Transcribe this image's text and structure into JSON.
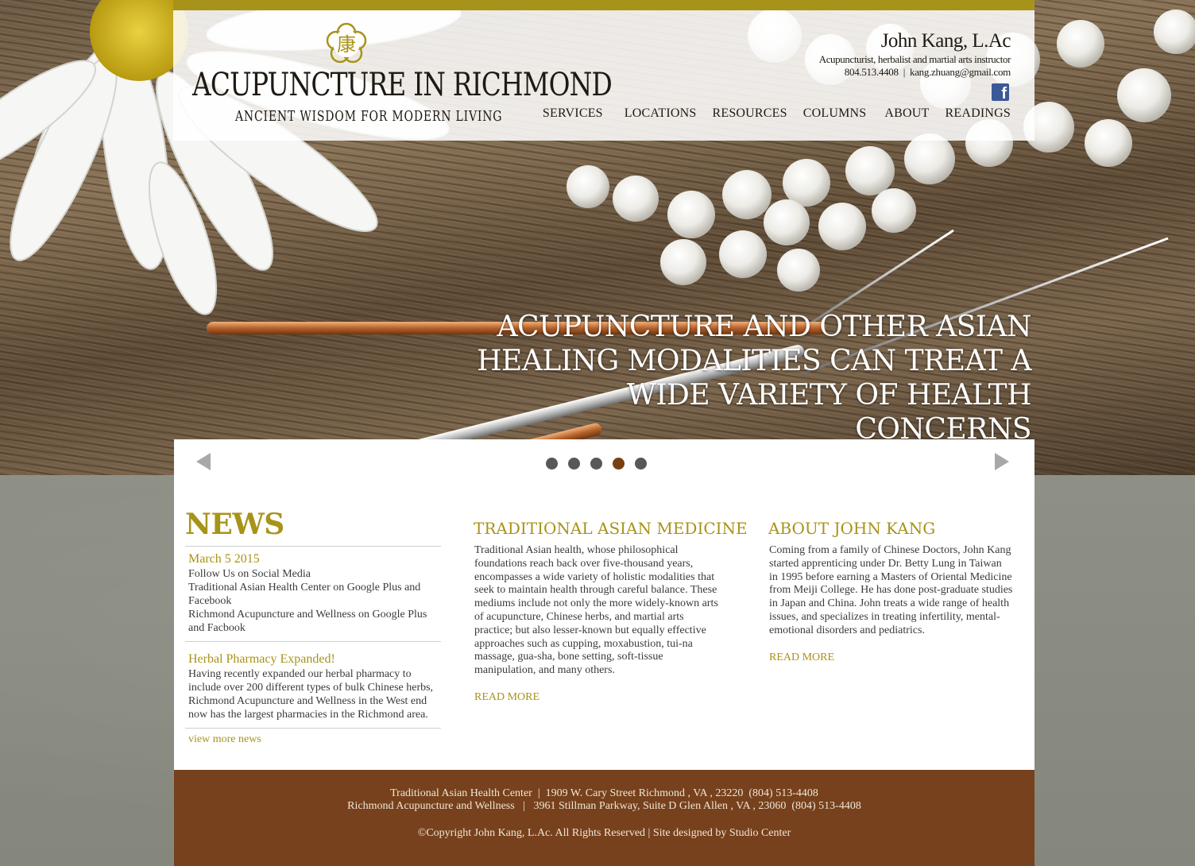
{
  "header": {
    "logo_title": "ACUPUNCTURE IN RICHMOND",
    "logo_tagline": "ANCIENT WISDOM FOR MODERN LIVING",
    "contact_name": "John Kang, L.Ac",
    "contact_role": "Acupuncturist, herbalist and martial arts instructor",
    "contact_phone": "804.513.4408",
    "contact_separator": "|",
    "contact_email": "kang.zhuang@gmail.com",
    "facebook_icon_glyph": "f"
  },
  "nav": {
    "items": [
      {
        "label": "SERVICES"
      },
      {
        "label": "LOCATIONS"
      },
      {
        "label": "RESOURCES"
      },
      {
        "label": "COLUMNS"
      },
      {
        "label": "ABOUT"
      },
      {
        "label": "READINGS"
      }
    ]
  },
  "hero": {
    "line1": "ACUPUNCTURE AND OTHER ASIAN",
    "line2": "HEALING MODALITIES CAN TREAT A",
    "line3": "WIDE VARIETY OF HEALTH CONCERNS"
  },
  "slider": {
    "dot_count": 5,
    "active_index": 3,
    "active_color": "#7a3e14",
    "dot_color": "#58585a"
  },
  "news": {
    "heading": "NEWS",
    "items": [
      {
        "date": "March 5 2015",
        "lines": [
          "Follow Us on Social Media",
          "Traditional Asian Health Center on Google Plus and Facebook",
          "Richmond Acupuncture and Wellness on Google Plus and Facbook"
        ]
      },
      {
        "title": "Herbal Pharmacy Expanded!",
        "body": "Having recently expanded our herbal pharmacy to include over 200 different types of bulk Chinese herbs, Richmond Acupuncture and Wellness in the West end now has the largest pharmacies in the Richmond area."
      }
    ],
    "more_link": "view more news"
  },
  "tam": {
    "heading": "TRADITIONAL ASIAN MEDICINE",
    "body": "Traditional Asian health, whose philosophical foundations reach back over five-thousand years, encompasses a wide variety of holistic modalities that seek to maintain health through careful balance. These mediums include not only the more widely-known arts of acupuncture, Chinese herbs, and martial arts practice; but also lesser-known but equally effective approaches such as cupping, moxabustion, tui-na massage, gua-sha, bone setting, soft-tissue manipulation, and many others.",
    "read_more": "READ MORE"
  },
  "about": {
    "heading": "ABOUT JOHN KANG",
    "body": "Coming from a family of Chinese Doctors, John Kang started apprenticing under Dr. Betty Lung in Taiwan in 1995 before earning a Masters of Oriental Medicine from Meiji College. He has done post-graduate studies in Japan and China. John treats a wide range of health issues, and specializes in treating infertility, mental-emotional disorders and pediatrics.",
    "read_more": "READ MORE"
  },
  "footer": {
    "line1": "Traditional Asian Health Center  |  1909 W. Cary Street Richmond , VA , 23220  (804) 513-4408",
    "line2": "Richmond Acupuncture and Wellness   |   3961 Stillman Parkway, Suite D Glen Allen , VA , 23060  (804) 513-4408",
    "copyright": "©Copyright John Kang, L.Ac. All Rights Reserved",
    "copy_sep": " | ",
    "designer": "Site designed by Studio Center"
  },
  "colors": {
    "accent_gold": "#a8931a",
    "footer_brown": "#76411c",
    "facebook_blue": "#3b5998"
  },
  "icons": {
    "logo": "chinese-seal-flower-icon",
    "facebook": "facebook-icon",
    "prev": "triangle-left-icon",
    "next": "triangle-right-icon"
  }
}
